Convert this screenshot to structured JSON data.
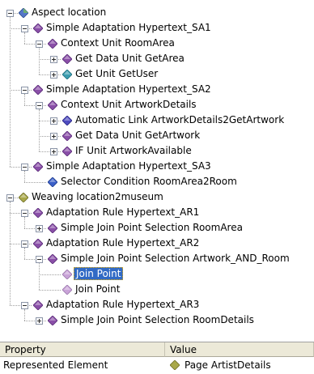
{
  "tree": {
    "nodes": [
      {
        "label": "Aspect location",
        "level": 0,
        "toggle": "minus",
        "icon": "diamond-blue-green-icon",
        "name": "tree-node-aspect-location"
      },
      {
        "label": "Simple Adaptation Hypertext_SA1",
        "level": 1,
        "toggle": "minus",
        "icon": "diamond-purple-icon",
        "name": "tree-node-simple-adaptation-sa1"
      },
      {
        "label": "Context Unit RoomArea",
        "level": 2,
        "toggle": "minus",
        "icon": "diamond-purple-icon",
        "name": "tree-node-context-unit-roomarea"
      },
      {
        "label": "Get Data Unit GetArea",
        "level": 3,
        "toggle": "plus",
        "icon": "diamond-purple-icon",
        "name": "tree-node-get-data-unit-getarea"
      },
      {
        "label": "Get Unit GetUser",
        "level": 3,
        "toggle": "plus",
        "icon": "diamond-teal-icon",
        "name": "tree-node-get-unit-getuser"
      },
      {
        "label": "Simple Adaptation Hypertext_SA2",
        "level": 1,
        "toggle": "minus",
        "icon": "diamond-purple-icon",
        "name": "tree-node-simple-adaptation-sa2"
      },
      {
        "label": "Context Unit ArtworkDetails",
        "level": 2,
        "toggle": "minus",
        "icon": "diamond-purple-icon",
        "name": "tree-node-context-unit-artworkdetails"
      },
      {
        "label": "Automatic Link ArtworkDetails2GetArtwork",
        "level": 3,
        "toggle": "plus",
        "icon": "diamond-blue-purple-icon",
        "name": "tree-node-automatic-link"
      },
      {
        "label": "Get Data Unit GetArtwork",
        "level": 3,
        "toggle": "plus",
        "icon": "diamond-purple-icon",
        "name": "tree-node-get-data-unit-getartwork"
      },
      {
        "label": "IF Unit ArtworkAvailable",
        "level": 3,
        "toggle": "plus",
        "icon": "diamond-purple-icon",
        "name": "tree-node-if-unit-artworkavailable"
      },
      {
        "label": "Simple Adaptation Hypertext_SA3",
        "level": 1,
        "toggle": "minus",
        "icon": "diamond-purple-icon",
        "name": "tree-node-simple-adaptation-sa3"
      },
      {
        "label": "Selector Condition RoomArea2Room",
        "level": 2,
        "toggle": "none",
        "icon": "diamond-blue-icon",
        "name": "tree-node-selector-condition"
      },
      {
        "label": "Weaving location2museum",
        "level": 0,
        "toggle": "minus",
        "icon": "diamond-olive-icon",
        "name": "tree-node-weaving-location2museum"
      },
      {
        "label": "Adaptation Rule Hypertext_AR1",
        "level": 1,
        "toggle": "minus",
        "icon": "diamond-purple-icon",
        "name": "tree-node-adaptation-rule-ar1"
      },
      {
        "label": "Simple Join Point Selection RoomArea",
        "level": 2,
        "toggle": "plus",
        "icon": "diamond-purple-icon",
        "name": "tree-node-join-point-selection-roomarea"
      },
      {
        "label": "Adaptation Rule Hypertext_AR2",
        "level": 1,
        "toggle": "minus",
        "icon": "diamond-purple-icon",
        "name": "tree-node-adaptation-rule-ar2"
      },
      {
        "label": "Simple Join Point Selection Artwork_AND_Room",
        "level": 2,
        "toggle": "minus",
        "icon": "diamond-purple-icon",
        "name": "tree-node-join-point-selection-artwork-and-room"
      },
      {
        "label": "Join Point",
        "level": 3,
        "toggle": "none",
        "icon": "diamond-pale-purple-icon",
        "name": "tree-node-join-point-1",
        "selected": true
      },
      {
        "label": "Join Point",
        "level": 3,
        "toggle": "none",
        "icon": "diamond-pale-purple-icon",
        "name": "tree-node-join-point-2"
      },
      {
        "label": "Adaptation Rule Hypertext_AR3",
        "level": 1,
        "toggle": "minus",
        "icon": "diamond-purple-icon",
        "name": "tree-node-adaptation-rule-ar3"
      },
      {
        "label": "Simple Join Point Selection RoomDetails",
        "level": 2,
        "toggle": "plus",
        "icon": "diamond-purple-icon",
        "name": "tree-node-join-point-selection-roomdetails"
      }
    ]
  },
  "properties": {
    "header_property": "Property",
    "header_value": "Value",
    "rows": [
      {
        "property": "Represented Element",
        "value": "Page ArtistDetails",
        "icon": "diamond-olive-icon"
      }
    ]
  },
  "colors": {
    "selection": "#316ac5",
    "purple": "#8a4fa8",
    "teal": "#3c9db0",
    "blue": "#3a5fc8",
    "olive": "#a9a84a",
    "pale_purple": "#c9a3d8"
  }
}
